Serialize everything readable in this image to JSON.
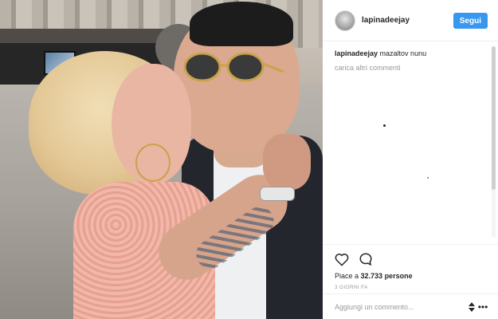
{
  "post": {
    "username": "lapinadeejay",
    "follow_label": "Segui",
    "caption": {
      "username": "lapinadeejay",
      "text": "mazaltov nunu"
    },
    "load_more_label": "carica altri commenti",
    "partial_comment": "... ...",
    "likes_prefix": "Piace a ",
    "likes_count": "32.733",
    "likes_suffix": " persone",
    "time_label": "3 GIORNI FA",
    "comment_placeholder": "Aggiungi un commento...",
    "more_label": "•••"
  },
  "icons": {
    "like": "heart-icon",
    "comment": "comment-bubble-icon",
    "stepper": "stepper-icon",
    "more": "more-options-icon"
  },
  "colors": {
    "follow_button": "#3897f0",
    "text": "#262626",
    "muted": "#999999",
    "border": "#efefef"
  }
}
